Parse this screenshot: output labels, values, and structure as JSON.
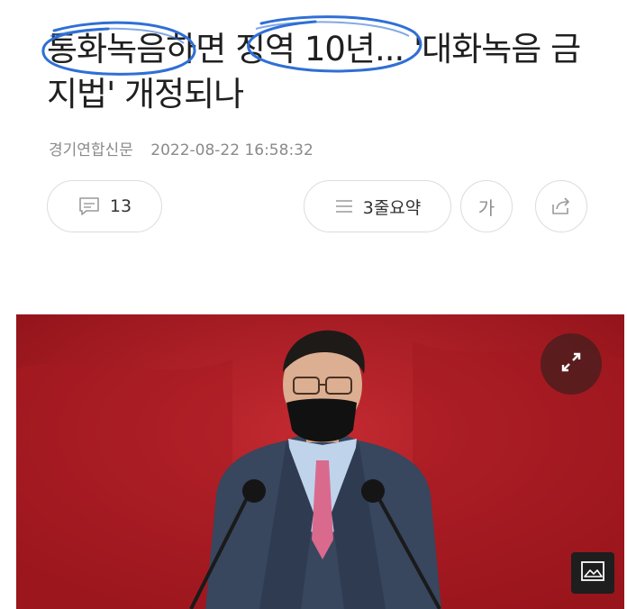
{
  "article": {
    "headline": "통화녹음하면 징역 10년... '대화녹음 금지법' 개정되나",
    "source": "경기연합신문",
    "datetime": "2022-08-22 16:58:32"
  },
  "actions": {
    "comment_count": "13",
    "summary_label": "3줄요약",
    "font_label": "가"
  },
  "icons": {
    "comment": "comment-icon",
    "summary": "list-icon",
    "share": "share-icon",
    "expand": "expand-icon",
    "gallery": "image-icon"
  },
  "colors": {
    "annotation": "#2f6fd6",
    "photo_bg": "#b51e27",
    "meta_text": "#8a8a8a"
  }
}
